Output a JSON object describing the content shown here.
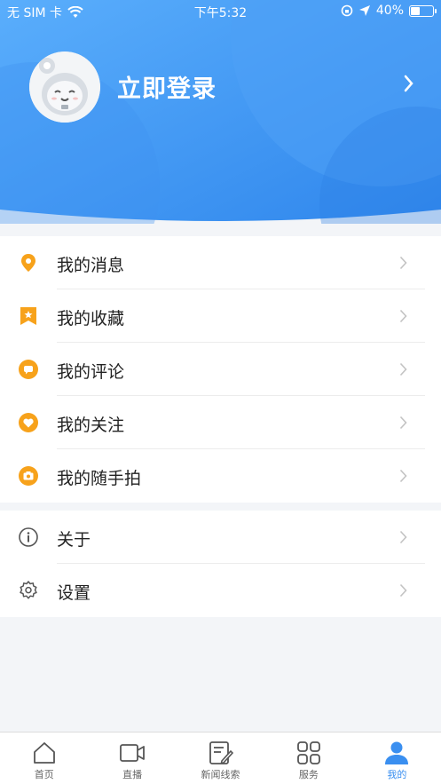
{
  "status_bar": {
    "carrier": "无 SIM 卡",
    "time": "下午5:32",
    "battery": "40%",
    "battery_level": 0.4
  },
  "profile": {
    "login_label": "立即登录"
  },
  "menu_primary": [
    {
      "label": "我的消息",
      "icon": "location-pin-icon"
    },
    {
      "label": "我的收藏",
      "icon": "bookmark-star-icon"
    },
    {
      "label": "我的评论",
      "icon": "comment-icon"
    },
    {
      "label": "我的关注",
      "icon": "heart-icon"
    },
    {
      "label": "我的随手拍",
      "icon": "camera-icon"
    }
  ],
  "menu_secondary": [
    {
      "label": "关于",
      "icon": "info-icon"
    },
    {
      "label": "设置",
      "icon": "gear-icon"
    }
  ],
  "tabbar": [
    {
      "label": "首页",
      "icon": "home-icon"
    },
    {
      "label": "直播",
      "icon": "video-icon"
    },
    {
      "label": "新闻线索",
      "icon": "edit-note-icon"
    },
    {
      "label": "服务",
      "icon": "grid-icon"
    },
    {
      "label": "我的",
      "icon": "user-icon",
      "active": true
    }
  ],
  "colors": {
    "header_blue": "#3a8ff0",
    "accent_orange": "#f7a21b",
    "active_tab": "#3a8ff0"
  }
}
